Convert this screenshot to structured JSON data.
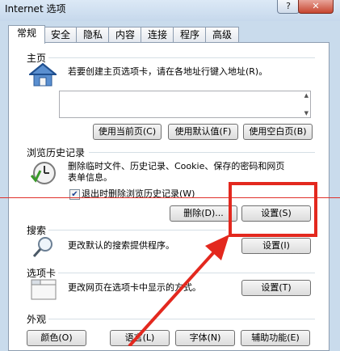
{
  "window": {
    "title": "Internet 选项",
    "help_label": "?",
    "close_label": "✕"
  },
  "tabs": [
    "常规",
    "安全",
    "隐私",
    "内容",
    "连接",
    "程序",
    "高级"
  ],
  "home": {
    "title": "主页",
    "description": "若要创建主页选项卡，请在各地址行键入地址(R)。",
    "use_current": "使用当前页(C)",
    "use_default": "使用默认值(F)",
    "use_blank": "使用空白页(B)"
  },
  "history": {
    "title": "浏览历史记录",
    "desc_line1": "删除临时文件、历史记录、Cookie、保存的密码和网页",
    "desc_line2": "表单信息。",
    "checkbox_label": "退出时删除浏览历史记录(W)",
    "checkbox_checked": true,
    "delete_button": "删除(D)...",
    "settings_button": "设置(S)"
  },
  "search": {
    "title": "搜索",
    "description": "更改默认的搜索提供程序。",
    "settings_button": "设置(I)"
  },
  "tabs_section": {
    "title": "选项卡",
    "description": "更改网页在选项卡中显示的方式。",
    "settings_button": "设置(T)"
  },
  "appearance": {
    "title": "外观",
    "colors": "颜色(O)",
    "languages": "语言(L)",
    "fonts": "字体(N)",
    "accessibility": "辅助功能(E)"
  },
  "colors": {
    "annotation": "#e3281e",
    "window_bg": "#c9dbec"
  }
}
